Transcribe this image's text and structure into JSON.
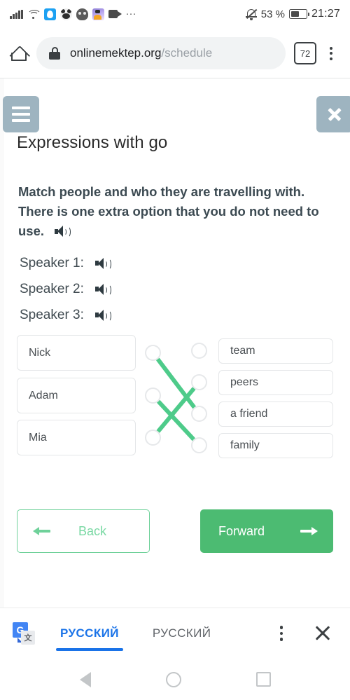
{
  "status_bar": {
    "battery_percent": "53 %",
    "time": "21:27",
    "icons": [
      "signal-icon",
      "wifi-icon",
      "twitter-icon",
      "panda-app-icon",
      "skull-app-icon",
      "photo-app-icon",
      "video-camera-icon",
      "overflow-dots-icon",
      "notifications-muted-icon",
      "battery-icon"
    ]
  },
  "browser": {
    "home_icon": "home-icon",
    "lock_icon": "lock-icon",
    "url_domain": "onlinemektep.org",
    "url_path": "/schedule",
    "tab_count": "72",
    "menu_icon": "kebab-menu-icon"
  },
  "lesson": {
    "menu_label": "",
    "close_label": "",
    "title": "Expressions with go",
    "prompt": "Match people and who they are travelling with. There is one extra option that you do not need to use.",
    "speakers": [
      {
        "label": "Speaker 1:"
      },
      {
        "label": "Speaker 2:"
      },
      {
        "label": "Speaker 3:"
      }
    ],
    "left_options": [
      {
        "label": "Nick"
      },
      {
        "label": "Adam"
      },
      {
        "label": "Mia"
      }
    ],
    "right_options": [
      {
        "label": "team"
      },
      {
        "label": "peers"
      },
      {
        "label": "a friend"
      },
      {
        "label": "family"
      }
    ],
    "connections": [
      {
        "from": 0,
        "to": 2
      },
      {
        "from": 1,
        "to": 3
      },
      {
        "from": 2,
        "to": 1
      }
    ],
    "line_color": "#4ecb8a",
    "back_label": "Back",
    "forward_label": "Forward",
    "accent_green": "#4cbb72",
    "header_button_color": "#9eb4c0"
  },
  "translate_bar": {
    "logo": "google-translate-icon",
    "source_language": "РУССКИЙ",
    "target_language": "РУССКИЙ",
    "menu_icon": "kebab-menu-icon",
    "close_icon": "close-icon",
    "active_color": "#1a73e8"
  },
  "android_nav": {
    "back": "back-triangle-icon",
    "home": "home-circle-icon",
    "recents": "recents-square-icon"
  }
}
